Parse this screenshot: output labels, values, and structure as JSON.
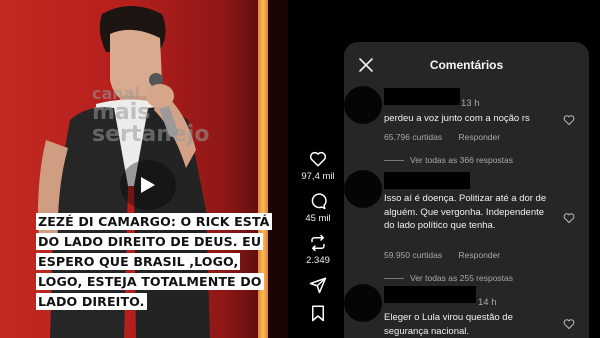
{
  "video": {
    "watermark_line1": "canal",
    "watermark_line2": "mais sertanejo",
    "caption": "ZEZÉ DI CAMARGO: O RICK ESTÁ DO LADO DIREITO DE DEUS. EU ESPERO QUE BRASIL ,LOGO, LOGO, ESTEJA TOTALMENTE DO LADO DIREITO."
  },
  "actions": {
    "likes": "97,4 mil",
    "comments": "45 mil",
    "reposts": "2.349"
  },
  "comments_panel": {
    "title": "Comentários",
    "comments": [
      {
        "time": "13 h",
        "text": "perdeu a voz junto com a noção rs",
        "likes": "65.796 curtidas",
        "reply_label": "Responder",
        "view_replies": "Ver todas as 366 respostas"
      },
      {
        "time": "",
        "text": "Isso aí é doença. Politizar até a dor de alguém. Que vergonha. Independente do lado político que tenha.",
        "likes": "59.950 curtidas",
        "reply_label": "Responder",
        "view_replies": "Ver todas as 255 respostas"
      },
      {
        "time": "14 h",
        "text": "Eleger o Lula virou questão de segurança nacional.",
        "likes": "",
        "reply_label": "",
        "view_replies": ""
      }
    ]
  }
}
